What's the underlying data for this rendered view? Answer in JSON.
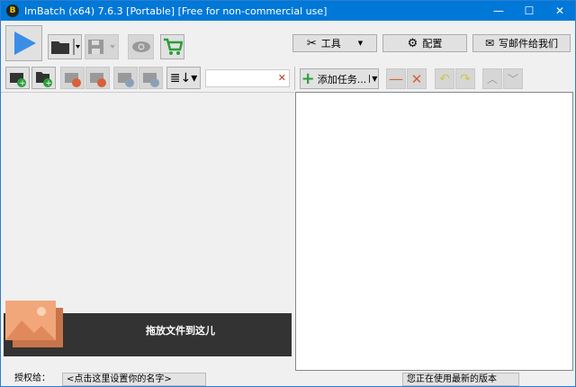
{
  "window": {
    "title": "ImBatch (x64) 7.6.3 [Portable] [Free for non-commercial use]",
    "logo": "B",
    "minimize": "—",
    "maximize": "☐",
    "close": "✕"
  },
  "toolbar": {
    "tools_label": "工具",
    "config_label": "配置",
    "email_label": "写邮件给我们"
  },
  "tasks": {
    "add_label": "添加任务..."
  },
  "search": {
    "value": "",
    "clear": "✕"
  },
  "drop_zone": {
    "label": "拖放文件到这儿"
  },
  "status": {
    "license_label": "授权给：",
    "license_value": "<点击这里设置你的名字>",
    "version_text": "您正在使用最新的版本"
  },
  "colors": {
    "accent": "#0078d7",
    "play": "#3a8ee6",
    "green": "#2a9d3a",
    "orange": "#d9603b"
  }
}
